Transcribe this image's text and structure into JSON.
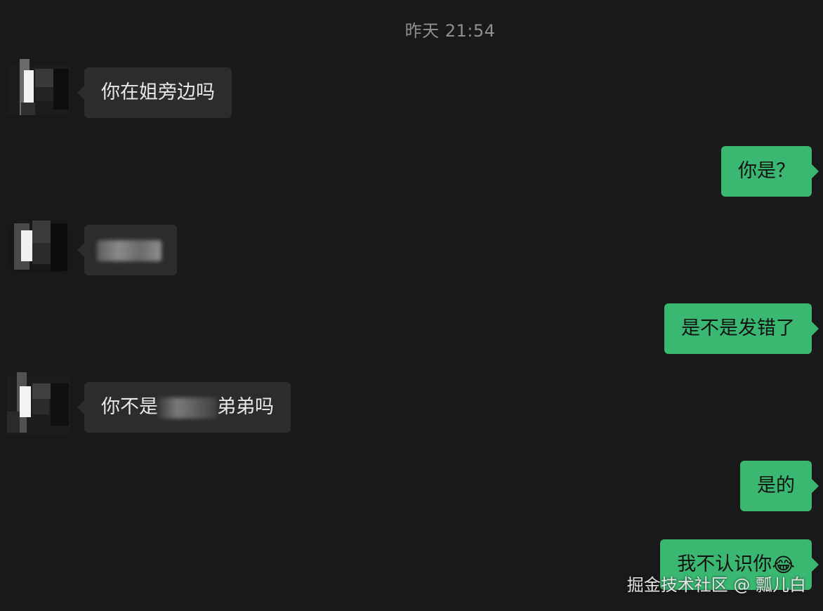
{
  "timestamp": "昨天 21:54",
  "messages": [
    {
      "direction": "in",
      "text": "你在姐旁边吗"
    },
    {
      "direction": "out",
      "text": "你是？"
    },
    {
      "direction": "in",
      "text": "[blurred]"
    },
    {
      "direction": "out",
      "text": "是不是发错了"
    },
    {
      "direction": "in",
      "text_before": "你不是",
      "text_after": "弟弟吗"
    },
    {
      "direction": "out",
      "text": "是的"
    },
    {
      "direction": "out",
      "text": "我不认识你",
      "emoji": "😂"
    }
  ],
  "watermark": "掘金技术社区 @ 瓢儿白",
  "colors": {
    "background": "#191919",
    "incoming_bubble": "#2c2c2c",
    "outgoing_bubble": "#3ab872"
  }
}
